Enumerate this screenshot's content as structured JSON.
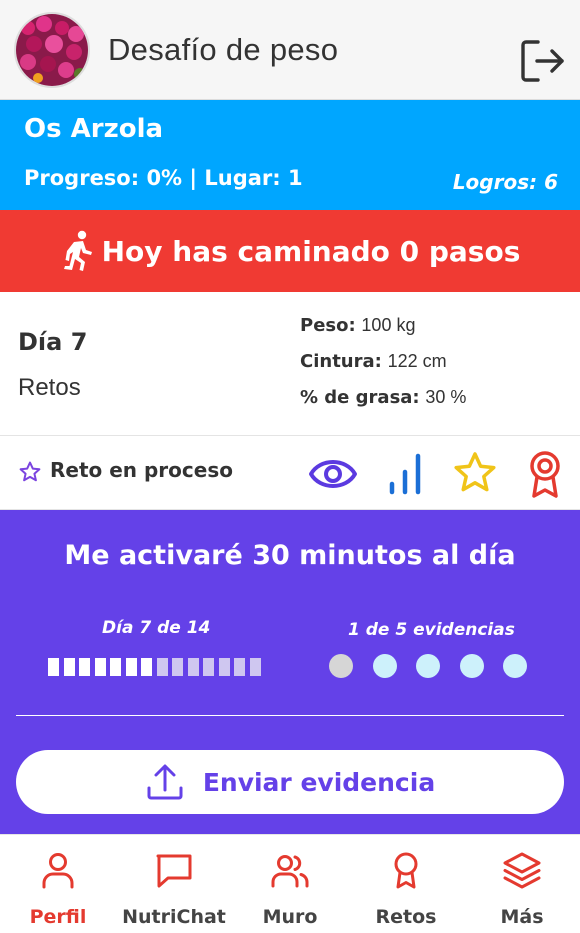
{
  "header": {
    "title": "Desafío de peso",
    "avatar_icon": "flower-avatar",
    "logout_icon": "logout-icon"
  },
  "user": {
    "name": "Os Arzola",
    "stats": "Progreso: 0% | Lugar: 1",
    "logros": "Logros: 6"
  },
  "steps": {
    "icon": "walking-icon",
    "text": "Hoy has caminado 0 pasos"
  },
  "day": {
    "label": "Día 7",
    "section": "Retos",
    "metrics": [
      {
        "label": "Peso:",
        "value": "100 kg"
      },
      {
        "label": "Cintura:",
        "value": "122 cm"
      },
      {
        "label": "% de grasa:",
        "value": "30 %"
      }
    ]
  },
  "challenge": {
    "status": "Reto en proceso",
    "actions": [
      "eye-icon",
      "signal-bars-icon",
      "star-icon",
      "award-icon"
    ]
  },
  "panel": {
    "title": "Me activaré 30 minutos al día",
    "day_progress": "Día 7 de 14",
    "days_done": 7,
    "days_total": 14,
    "evidence_progress": "1 de 5 evidencias",
    "evidence_done": 1,
    "evidence_total": 5,
    "send_label": "Enviar evidencia"
  },
  "nav": [
    {
      "label": "Perfil",
      "icon": "user-icon",
      "active": true
    },
    {
      "label": "NutriChat",
      "icon": "chat-icon",
      "active": false
    },
    {
      "label": "Muro",
      "icon": "users-icon",
      "active": false
    },
    {
      "label": "Retos",
      "icon": "award-icon",
      "active": false
    },
    {
      "label": "Más",
      "icon": "layers-icon",
      "active": false
    }
  ],
  "colors": {
    "blue": "#00a6ff",
    "red": "#f03a33",
    "purple": "#6441e8",
    "accent_red": "#e43a2f"
  }
}
